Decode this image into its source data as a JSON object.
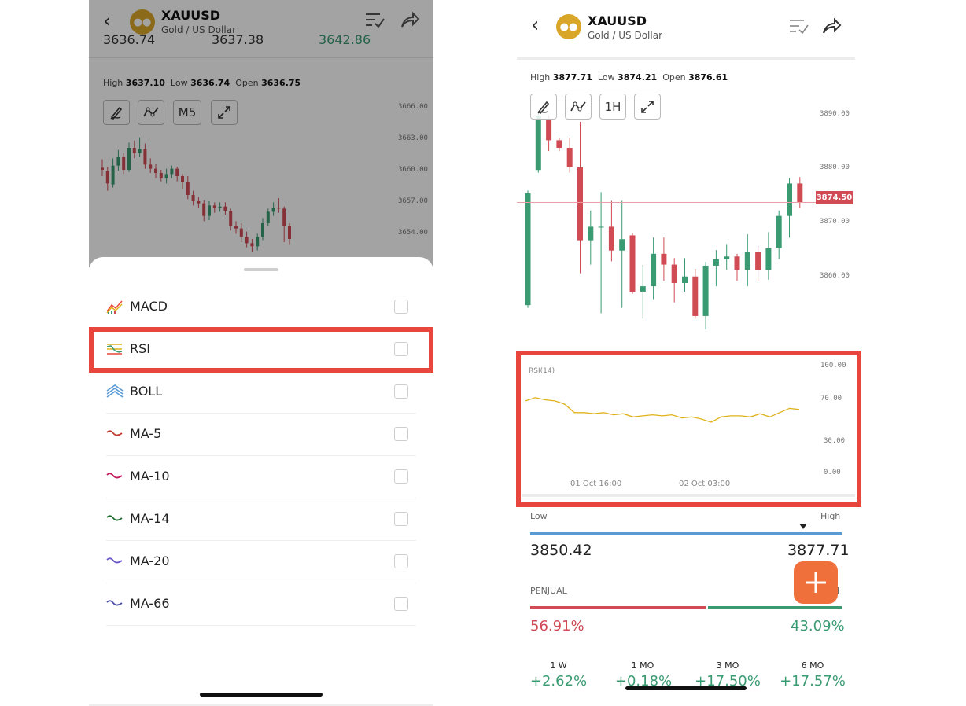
{
  "left_screen": {
    "header": {
      "symbol": "XAUUSD",
      "name": "Gold / US Dollar",
      "back_icon": "chevron-left-icon",
      "list_icon": "checklist-icon",
      "share_icon": "share-icon"
    },
    "partial_prices": [
      "3636.74",
      "3637.38",
      "3642.86"
    ],
    "stats": {
      "high_label": "High",
      "high": "3637.10",
      "low_label": "Low",
      "low": "3636.74",
      "open_label": "Open",
      "open": "3636.75"
    },
    "toolbar": {
      "draw_icon": "pen-icon",
      "indicator_icon": "line-chart-icon",
      "timeframe": "M5",
      "expand_icon": "expand-icon"
    },
    "price_axis": [
      "3666.00",
      "3663.00",
      "3660.00",
      "3657.00",
      "3654.00"
    ],
    "indicators": [
      {
        "label": "MACD",
        "icon": "macd-icon",
        "checked": false
      },
      {
        "label": "RSI",
        "icon": "rsi-icon",
        "checked": false,
        "highlighted": true
      },
      {
        "label": "BOLL",
        "icon": "boll-icon",
        "checked": false
      },
      {
        "label": "MA-5",
        "icon": "wave-icon",
        "checked": false
      },
      {
        "label": "MA-10",
        "icon": "wave-icon",
        "checked": false
      },
      {
        "label": "MA-14",
        "icon": "wave-icon",
        "checked": false
      },
      {
        "label": "MA-20",
        "icon": "wave-icon",
        "checked": false
      },
      {
        "label": "MA-66",
        "icon": "wave-icon",
        "checked": false
      }
    ]
  },
  "right_screen": {
    "header": {
      "symbol": "XAUUSD",
      "name": "Gold / US Dollar",
      "back_icon": "chevron-left-icon",
      "list_icon": "checklist-icon",
      "share_icon": "share-icon"
    },
    "stats": {
      "high_label": "High",
      "high": "3877.71",
      "low_label": "Low",
      "low": "3874.21",
      "open_label": "Open",
      "open": "3876.61"
    },
    "toolbar": {
      "draw_icon": "pen-icon",
      "indicator_icon": "line-chart-icon",
      "timeframe": "1H",
      "expand_icon": "expand-icon"
    },
    "price_axis": [
      "3890.00",
      "3880.00",
      "3870.00",
      "3860.00"
    ],
    "current_price": "3874.50",
    "rsi": {
      "title": "RSI(14)",
      "axis": [
        "100.00",
        "70.00",
        "30.00",
        "0.00"
      ],
      "time_labels": [
        "01 Oct 16:00",
        "02 Oct 03:00"
      ]
    },
    "range": {
      "low_label": "Low",
      "high_label": "High",
      "low": "3850.42",
      "high": "3877.71"
    },
    "sentiment": {
      "seller_label": "PENJUAL",
      "buyer_label_partial": "I",
      "seller_pct": "56.91%",
      "buyer_pct": "43.09%"
    },
    "add_button_icon": "plus-icon",
    "performance": [
      {
        "label": "1 W",
        "value": "+2.62%"
      },
      {
        "label": "1 MO",
        "value": "+0.18%"
      },
      {
        "label": "3 MO",
        "value": "+17.50%"
      },
      {
        "label": "6 MO",
        "value": "+17.57%"
      }
    ]
  },
  "colors": {
    "highlight": "#e8453c",
    "up": "#3a9b72",
    "down": "#d14b55",
    "rsi_line": "#e0b21a",
    "range_bar": "#5b9bd5",
    "add_button": "#f0703c"
  },
  "chart_data": [
    {
      "type": "candlestick",
      "title": "",
      "ylim": [
        3654,
        3666
      ],
      "y_ticks": [
        3666.0,
        3663.0,
        3660.0,
        3657.0,
        3654.0
      ],
      "candles": [
        {
          "o": 3660.2,
          "c": 3660.0,
          "h": 3661.0,
          "l": 3659.4
        },
        {
          "o": 3659.9,
          "c": 3658.7,
          "h": 3660.3,
          "l": 3658.0
        },
        {
          "o": 3658.6,
          "c": 3660.4,
          "h": 3661.1,
          "l": 3658.3
        },
        {
          "o": 3660.4,
          "c": 3661.2,
          "h": 3661.9,
          "l": 3659.9
        },
        {
          "o": 3661.2,
          "c": 3660.0,
          "h": 3661.6,
          "l": 3659.6
        },
        {
          "o": 3660.0,
          "c": 3662.1,
          "h": 3662.6,
          "l": 3659.8
        },
        {
          "o": 3662.1,
          "c": 3661.6,
          "h": 3662.8,
          "l": 3661.1
        },
        {
          "o": 3661.6,
          "c": 3662.0,
          "h": 3663.1,
          "l": 3661.2
        },
        {
          "o": 3662.0,
          "c": 3660.5,
          "h": 3662.5,
          "l": 3660.1
        },
        {
          "o": 3660.5,
          "c": 3660.1,
          "h": 3661.1,
          "l": 3659.7
        },
        {
          "o": 3660.1,
          "c": 3659.7,
          "h": 3660.6,
          "l": 3659.2
        },
        {
          "o": 3659.7,
          "c": 3659.2,
          "h": 3660.0,
          "l": 3658.9
        },
        {
          "o": 3659.2,
          "c": 3659.6,
          "h": 3660.1,
          "l": 3658.7
        },
        {
          "o": 3659.6,
          "c": 3660.1,
          "h": 3660.4,
          "l": 3659.2
        },
        {
          "o": 3660.1,
          "c": 3659.4,
          "h": 3660.3,
          "l": 3658.9
        },
        {
          "o": 3659.4,
          "c": 3658.8,
          "h": 3659.6,
          "l": 3658.2
        },
        {
          "o": 3658.8,
          "c": 3657.6,
          "h": 3659.4,
          "l": 3657.2
        },
        {
          "o": 3657.6,
          "c": 3657.0,
          "h": 3658.0,
          "l": 3656.6
        },
        {
          "o": 3657.0,
          "c": 3656.8,
          "h": 3657.4,
          "l": 3656.4
        },
        {
          "o": 3656.8,
          "c": 3655.6,
          "h": 3657.1,
          "l": 3655.1
        },
        {
          "o": 3655.6,
          "c": 3656.6,
          "h": 3657.0,
          "l": 3655.2
        },
        {
          "o": 3656.6,
          "c": 3656.4,
          "h": 3656.9,
          "l": 3655.9
        },
        {
          "o": 3656.4,
          "c": 3656.5,
          "h": 3656.9,
          "l": 3656.0
        },
        {
          "o": 3656.5,
          "c": 3656.1,
          "h": 3656.9,
          "l": 3655.7
        },
        {
          "o": 3656.1,
          "c": 3654.6,
          "h": 3656.3,
          "l": 3654.2
        },
        {
          "o": 3654.6,
          "c": 3654.4,
          "h": 3655.1,
          "l": 3653.9
        },
        {
          "o": 3654.4,
          "c": 3653.6,
          "h": 3654.9,
          "l": 3653.1
        },
        {
          "o": 3653.6,
          "c": 3653.0,
          "h": 3654.1,
          "l": 3652.6
        },
        {
          "o": 3653.0,
          "c": 3652.7,
          "h": 3653.4,
          "l": 3652.2
        },
        {
          "o": 3652.7,
          "c": 3653.6,
          "h": 3653.9,
          "l": 3652.3
        },
        {
          "o": 3653.6,
          "c": 3654.9,
          "h": 3655.4,
          "l": 3653.3
        },
        {
          "o": 3654.9,
          "c": 3656.0,
          "h": 3656.3,
          "l": 3654.6
        },
        {
          "o": 3656.0,
          "c": 3656.4,
          "h": 3656.9,
          "l": 3655.6
        },
        {
          "o": 3656.4,
          "c": 3656.3,
          "h": 3657.3,
          "l": 3655.9
        },
        {
          "o": 3656.3,
          "c": 3654.6,
          "h": 3656.5,
          "l": 3653.1
        },
        {
          "o": 3654.6,
          "c": 3653.4,
          "h": 3654.9,
          "l": 3652.9
        }
      ]
    },
    {
      "type": "candlestick",
      "title": "",
      "ylim": [
        3850,
        3891
      ],
      "y_ticks": [
        3890.0,
        3880.0,
        3870.0,
        3860.0
      ],
      "current_price": 3874.5,
      "candles": [
        {
          "o": 3855.5,
          "c": 3876.2,
          "h": 3876.7,
          "l": 3855.0
        },
        {
          "o": 3880.5,
          "c": 3890.5,
          "h": 3891.0,
          "l": 3880.0
        },
        {
          "o": 3890.0,
          "c": 3886.0,
          "h": 3890.6,
          "l": 3884.0
        },
        {
          "o": 3886.0,
          "c": 3884.6,
          "h": 3886.5,
          "l": 3884.0
        },
        {
          "o": 3884.6,
          "c": 3881.0,
          "h": 3886.5,
          "l": 3880.0
        },
        {
          "o": 3881.0,
          "c": 3867.5,
          "h": 3889.4,
          "l": 3861.4
        },
        {
          "o": 3867.5,
          "c": 3870.0,
          "h": 3873.0,
          "l": 3863.0
        },
        {
          "o": 3870.0,
          "c": 3870.0,
          "h": 3876.4,
          "l": 3854.0
        },
        {
          "o": 3870.0,
          "c": 3865.6,
          "h": 3874.8,
          "l": 3863.6
        },
        {
          "o": 3865.6,
          "c": 3867.7,
          "h": 3874.8,
          "l": 3855.0
        },
        {
          "o": 3868.4,
          "c": 3858.0,
          "h": 3868.8,
          "l": 3857.6
        },
        {
          "o": 3858.0,
          "c": 3859.0,
          "h": 3863.0,
          "l": 3853.0
        },
        {
          "o": 3859.0,
          "c": 3865.0,
          "h": 3868.0,
          "l": 3856.6
        },
        {
          "o": 3865.0,
          "c": 3863.0,
          "h": 3868.0,
          "l": 3860.0
        },
        {
          "o": 3863.0,
          "c": 3859.6,
          "h": 3864.2,
          "l": 3856.0
        },
        {
          "o": 3859.6,
          "c": 3860.8,
          "h": 3864.2,
          "l": 3858.0
        },
        {
          "o": 3860.8,
          "c": 3853.5,
          "h": 3862.2,
          "l": 3853.0
        },
        {
          "o": 3853.5,
          "c": 3862.8,
          "h": 3863.5,
          "l": 3851.0
        },
        {
          "o": 3862.8,
          "c": 3864.0,
          "h": 3865.7,
          "l": 3859.0
        },
        {
          "o": 3864.0,
          "c": 3864.5,
          "h": 3866.8,
          "l": 3862.0
        },
        {
          "o": 3864.5,
          "c": 3862.0,
          "h": 3865.0,
          "l": 3860.0
        },
        {
          "o": 3862.0,
          "c": 3865.4,
          "h": 3868.6,
          "l": 3859.0
        },
        {
          "o": 3865.4,
          "c": 3862.0,
          "h": 3866.5,
          "l": 3860.0
        },
        {
          "o": 3862.0,
          "c": 3866.0,
          "h": 3869.0,
          "l": 3860.2
        },
        {
          "o": 3866.0,
          "c": 3872.0,
          "h": 3873.0,
          "l": 3864.0
        },
        {
          "o": 3872.0,
          "c": 3878.0,
          "h": 3879.0,
          "l": 3868.0
        },
        {
          "o": 3878.0,
          "c": 3874.5,
          "h": 3879.2,
          "l": 3873.5
        }
      ]
    },
    {
      "type": "line",
      "title": "RSI(14)",
      "ylim": [
        0,
        100
      ],
      "y_ticks": [
        100,
        70,
        30,
        0
      ],
      "x_tick_labels": [
        "01 Oct 16:00",
        "02 Oct 03:00"
      ],
      "series": [
        {
          "values": [
            67,
            70,
            68,
            67,
            64,
            56,
            56,
            55,
            56,
            54,
            55,
            52,
            53,
            54,
            53,
            54,
            51,
            52,
            50,
            47,
            52,
            53,
            53,
            52,
            55,
            52,
            56,
            60,
            59
          ]
        }
      ]
    }
  ]
}
